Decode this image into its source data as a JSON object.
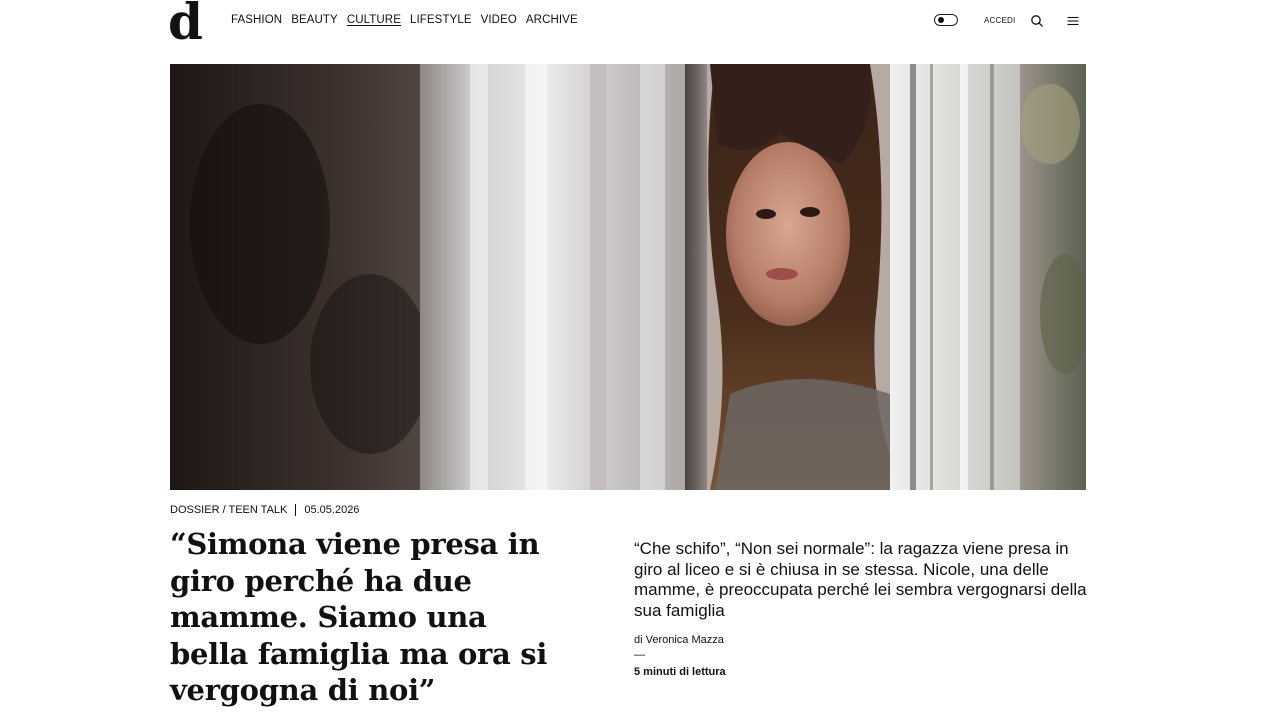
{
  "site": {
    "logo": "d"
  },
  "nav": {
    "items": [
      {
        "label": "FASHION",
        "active": false
      },
      {
        "label": "BEAUTY",
        "active": false
      },
      {
        "label": "CULTURE",
        "active": true
      },
      {
        "label": "LIFESTYLE",
        "active": false
      },
      {
        "label": "VIDEO",
        "active": false
      },
      {
        "label": "ARCHIVE",
        "active": false
      }
    ]
  },
  "header_actions": {
    "theme_toggle_icon": "theme-toggle-icon",
    "login_label": "ACCEDI",
    "search_icon": "search-icon",
    "menu_icon": "hamburger-menu-icon"
  },
  "article": {
    "category": "DOSSIER / TEEN TALK",
    "date": "05.05.2026",
    "headline": "“Simona viene presa in giro perché ha due mamme. Siamo una bella famiglia ma ora si vergogna di noi”",
    "summary": "“Che schifo”, “Non sei normale”: la ragazza viene presa in giro al liceo e si è chiusa in se stessa. Nicole, una delle mamme, è preoccupata perché lei sembra vergognarsi della sua famiglia",
    "byline": "di Veronica Mazza",
    "byline_dash": "—",
    "reading_time": "5 minuti di lettura"
  },
  "colors": {
    "text": "#111111",
    "background": "#ffffff",
    "hero_dark": "#2a2320"
  }
}
